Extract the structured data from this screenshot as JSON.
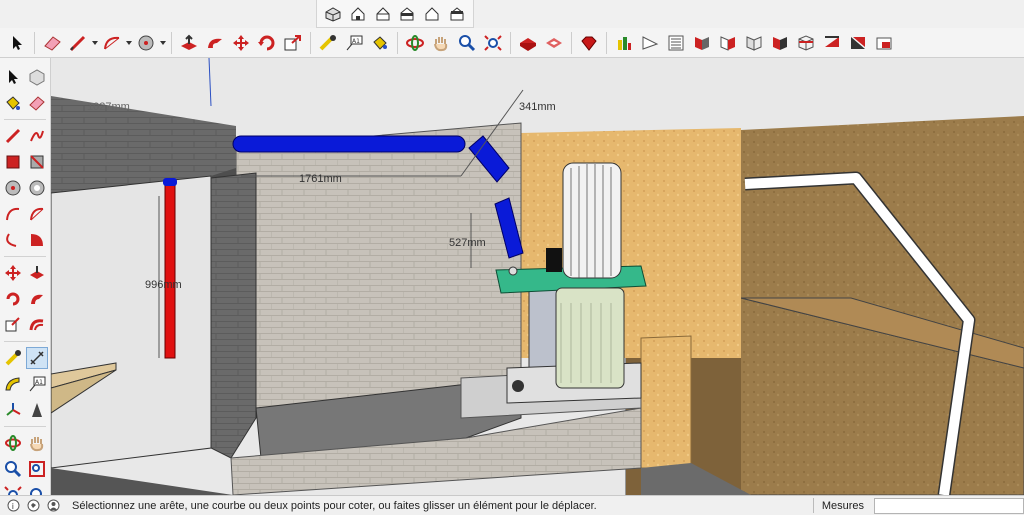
{
  "top_views": {
    "icons": [
      "iso-view-icon",
      "top-view-icon",
      "front-view-icon",
      "right-view-icon",
      "back-view-icon",
      "left-view-icon"
    ]
  },
  "main_toolbar": {
    "icons": [
      "select-icon",
      "eraser-icon",
      "pencil-line-icon",
      "arc-icon",
      "shape-icon",
      "push-pull-icon",
      "follow-me-icon",
      "move-icon",
      "rotate-icon",
      "scale-icon",
      "tape-measure-icon",
      "text-label-icon",
      "paint-bucket-icon",
      "orbit-icon",
      "pan-icon",
      "zoom-icon",
      "zoom-extents-icon",
      "warehouse-icon",
      "extension-warehouse-icon",
      "ruby-icon",
      "section-plane-icon",
      "style-icon",
      "layers-icon",
      "shadows-icon",
      "fog-icon",
      "xray-icon",
      "back-edges-icon",
      "wireframe-icon",
      "hidden-line-icon",
      "shaded-icon",
      "monochrome-icon"
    ]
  },
  "scene": {
    "dimensions": [
      {
        "label": "1761mm"
      },
      {
        "label": "341mm"
      },
      {
        "label": "527mm"
      },
      {
        "label": "996mm"
      },
      {
        "label": "1027mm"
      }
    ],
    "colors": {
      "sky": "#e8e8e8",
      "brick": "#c8c3bb",
      "brick_shadow": "#6e6e6e",
      "osb": "#e3b56b",
      "wood_dark": "#9a7a4a",
      "duct_blue": "#0a1ad8",
      "duct_red": "#e01010",
      "table_green": "#35b88a",
      "pipe_white": "#ffffff"
    }
  },
  "statusbar": {
    "message": "Sélectionnez une arête, une courbe ou deux points pour coter, ou faites glisser un élément pour le déplacer.",
    "measures_label": "Mesures",
    "measures_value": ""
  }
}
